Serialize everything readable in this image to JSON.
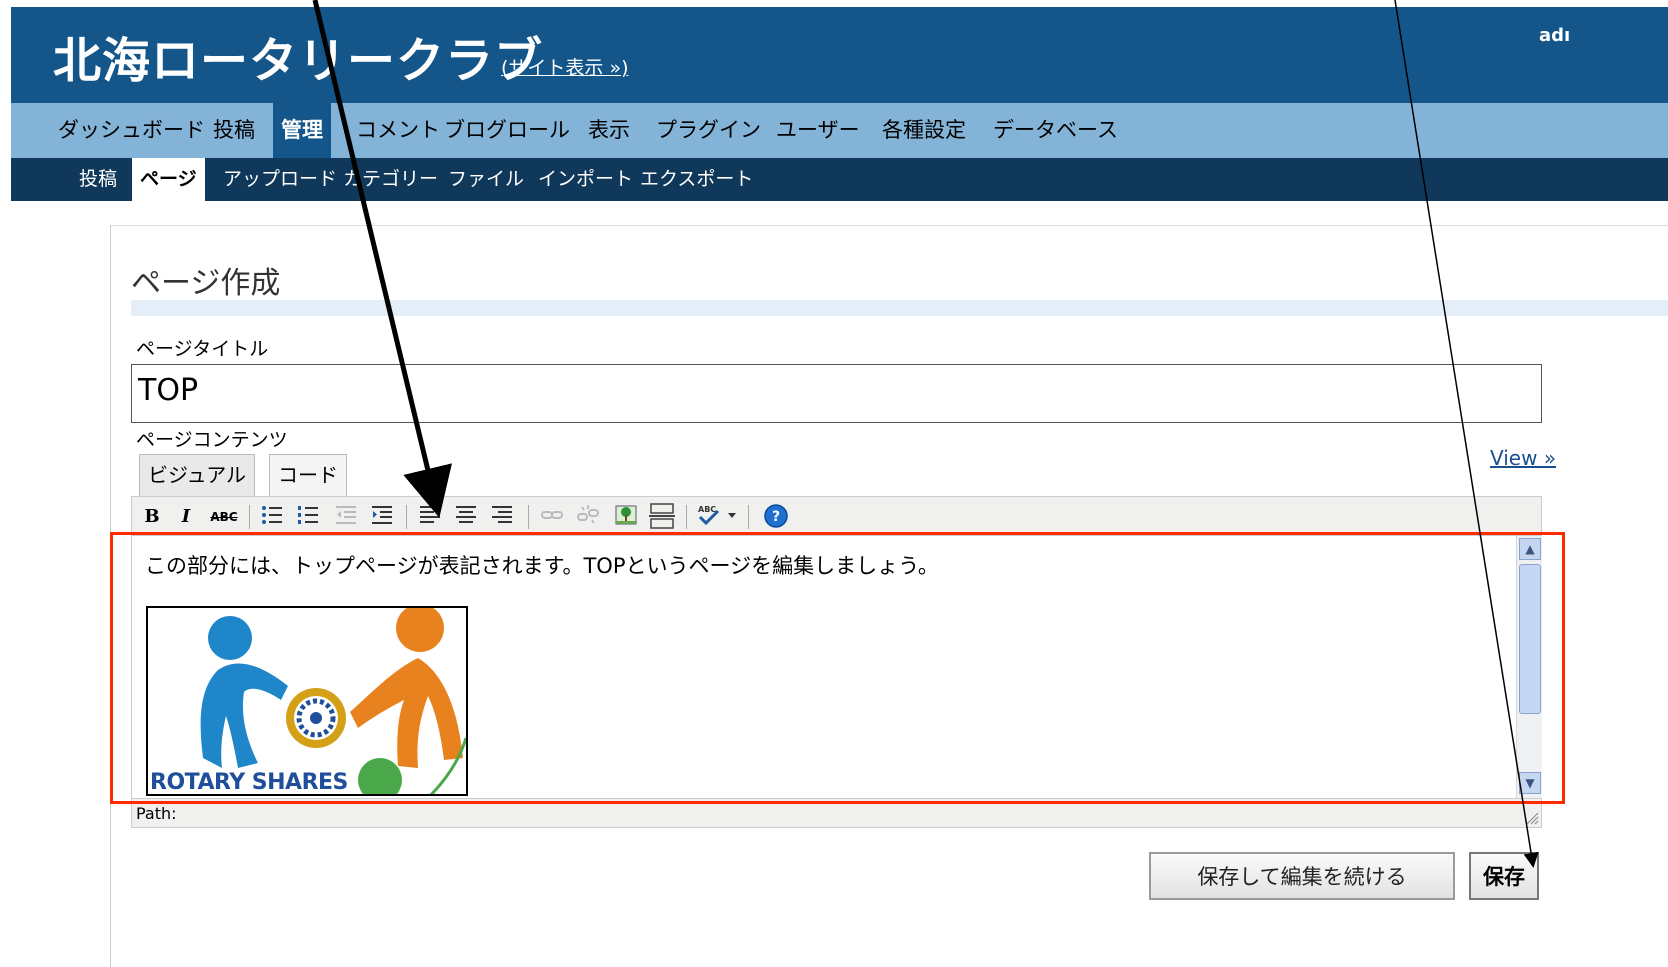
{
  "header": {
    "site_title": "北海ロータリークラブ",
    "site_view_link": "(サイト表示 »)",
    "user": "adı"
  },
  "nav_main": {
    "items": [
      "ダッシュボード",
      "投稿",
      "管理",
      "コメント",
      "ブログロール",
      "表示",
      "プラグイン",
      "ユーザー",
      "各種設定",
      "データベース"
    ]
  },
  "nav_sub": {
    "items": [
      "投稿",
      "ページ",
      "アップロード",
      "カテゴリー",
      "ファイル",
      "インポート",
      "エクスポート"
    ]
  },
  "main": {
    "heading": "ページ作成",
    "title_label": "ページタイトル",
    "title_value": "TOP",
    "content_label": "ページコンテンツ",
    "tabs": [
      "ビジュアル",
      "コード"
    ],
    "view_link": "View »",
    "editor_text": "この部分には、トップページが表記されます。TOPというページを編集しましょう。",
    "image_caption": "ROTARY SHARES",
    "path_label": "Path:"
  },
  "toolbar": {
    "bold": "B",
    "italic": "I",
    "strikethrough": "ABC",
    "icons": [
      "bold-icon",
      "italic-icon",
      "strikethrough-icon",
      "bullet-list-icon",
      "numbered-list-icon",
      "outdent-icon",
      "indent-icon",
      "align-left-icon",
      "align-center-icon",
      "align-right-icon",
      "link-icon",
      "unlink-icon",
      "image-icon",
      "more-break-icon",
      "spellcheck-icon",
      "help-icon"
    ]
  },
  "buttons": {
    "save_continue": "保存して編集を続ける",
    "save": "保存"
  },
  "colors": {
    "header": "#14568a",
    "nav_main": "#83b4d8",
    "nav_sub": "#10385a",
    "highlight": "#ff2a00",
    "logo_blue": "#1f86c9",
    "logo_orange": "#e8821e",
    "logo_green": "#4aa84a",
    "rotary_gold": "#d4a017"
  }
}
